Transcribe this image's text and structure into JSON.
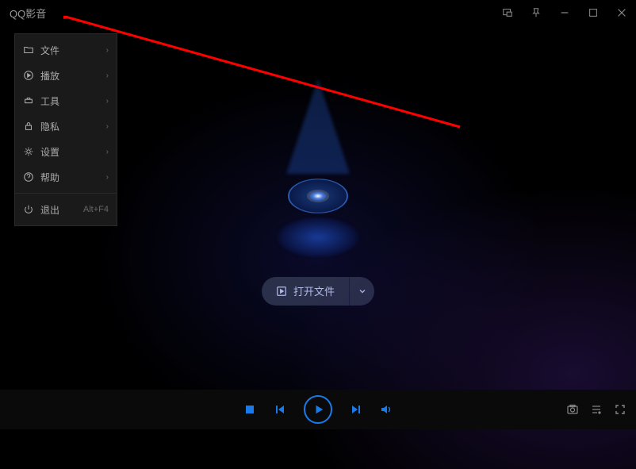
{
  "app": {
    "title": "QQ影音"
  },
  "menu": {
    "items": [
      {
        "icon": "folder",
        "label": "文件",
        "hasSub": true
      },
      {
        "icon": "play-circle",
        "label": "播放",
        "hasSub": true
      },
      {
        "icon": "tool",
        "label": "工具",
        "hasSub": true
      },
      {
        "icon": "lock",
        "label": "隐私",
        "hasSub": true
      },
      {
        "icon": "gear",
        "label": "设置",
        "hasSub": true
      },
      {
        "icon": "help",
        "label": "帮助",
        "hasSub": true
      }
    ],
    "exit": {
      "icon": "power",
      "label": "退出",
      "shortcut": "Alt+F4"
    }
  },
  "main": {
    "open_file_label": "打开文件"
  },
  "colors": {
    "accent": "#1a7aea",
    "arrow": "#ff0000"
  }
}
